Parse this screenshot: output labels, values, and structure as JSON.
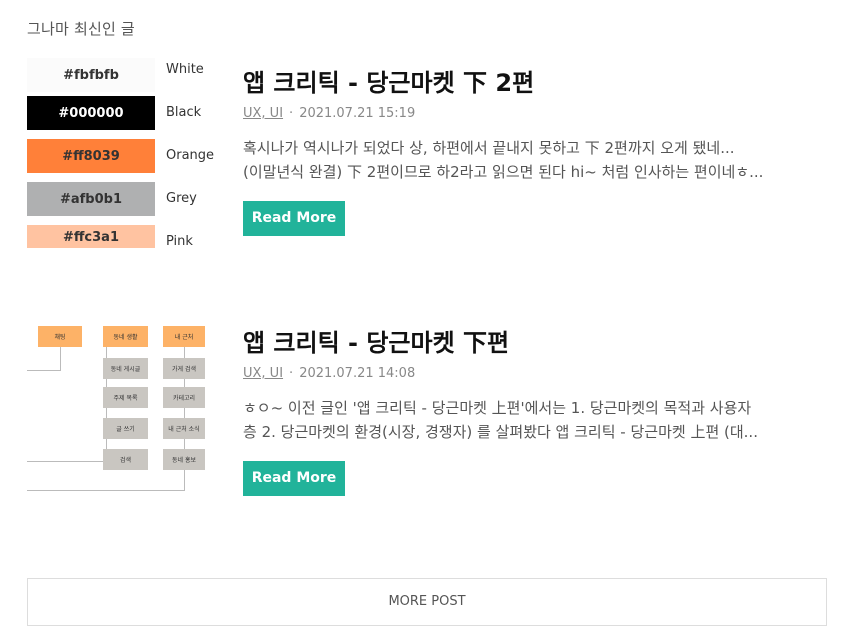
{
  "section": {
    "title": "그나마 최신인 글"
  },
  "posts": [
    {
      "title": "앱 크리틱 - 당근마켓 下 2편",
      "category": "UX, UI",
      "date": "2021.07.21 15:19",
      "excerpt": [
        "혹시나가 역시나가 되었다 상, 하편에서 끝내지 못하고 下 2편까지 오게 됐네...",
        "(이말년식 완결) 下 2편이므로 하2라고 읽으면 된다 hi~ 처럼 인사하는 편이네ㅎ..."
      ],
      "button": "Read More",
      "thumbnail": {
        "swatches": [
          {
            "code": "#fbfbfb",
            "name": "White",
            "color": "#fbfbfb",
            "text": "#333333"
          },
          {
            "code": "#000000",
            "name": "Black",
            "color": "#000000",
            "text": "#ffffff"
          },
          {
            "code": "#ff8039",
            "name": "Orange",
            "color": "#ff8039",
            "text": "#333333"
          },
          {
            "code": "#afb0b1",
            "name": "Grey",
            "color": "#afb0b1",
            "text": "#333333"
          },
          {
            "code": "#ffc3a1",
            "name": "Pink",
            "color": "#ffc3a1",
            "text": "#333333"
          }
        ]
      }
    },
    {
      "title": "앱 크리틱 - 당근마켓 下편",
      "category": "UX, UI",
      "date": "2021.07.21 14:08",
      "excerpt": [
        "ㅎㅇ~ 이전 글인 '앱 크리틱 - 당근마켓 上편'에서는 1. 당근마켓의 목적과 사용자",
        "층 2. 당근마켓의 환경(시장, 경쟁자) 를 살펴봤다 앱 크리틱 - 당근마켓 上편 (대..."
      ],
      "button": "Read More",
      "thumbnail": {
        "nodes": {
          "a": "채팅",
          "b": "동네 생활",
          "c": "내 근처",
          "b1": "동네 게시글",
          "b2": "주제 목록",
          "b3": "글 쓰기",
          "b4": "검색",
          "c1": "가게 검색",
          "c2": "카테고리",
          "c3": "내 근처 소식",
          "c4": "동네 홍보"
        }
      }
    }
  ],
  "more": {
    "label": "MORE POST"
  },
  "colors": {
    "accent": "#21b39a",
    "diagram_orange": "#fdb267",
    "diagram_grey": "#c9c6c1"
  }
}
